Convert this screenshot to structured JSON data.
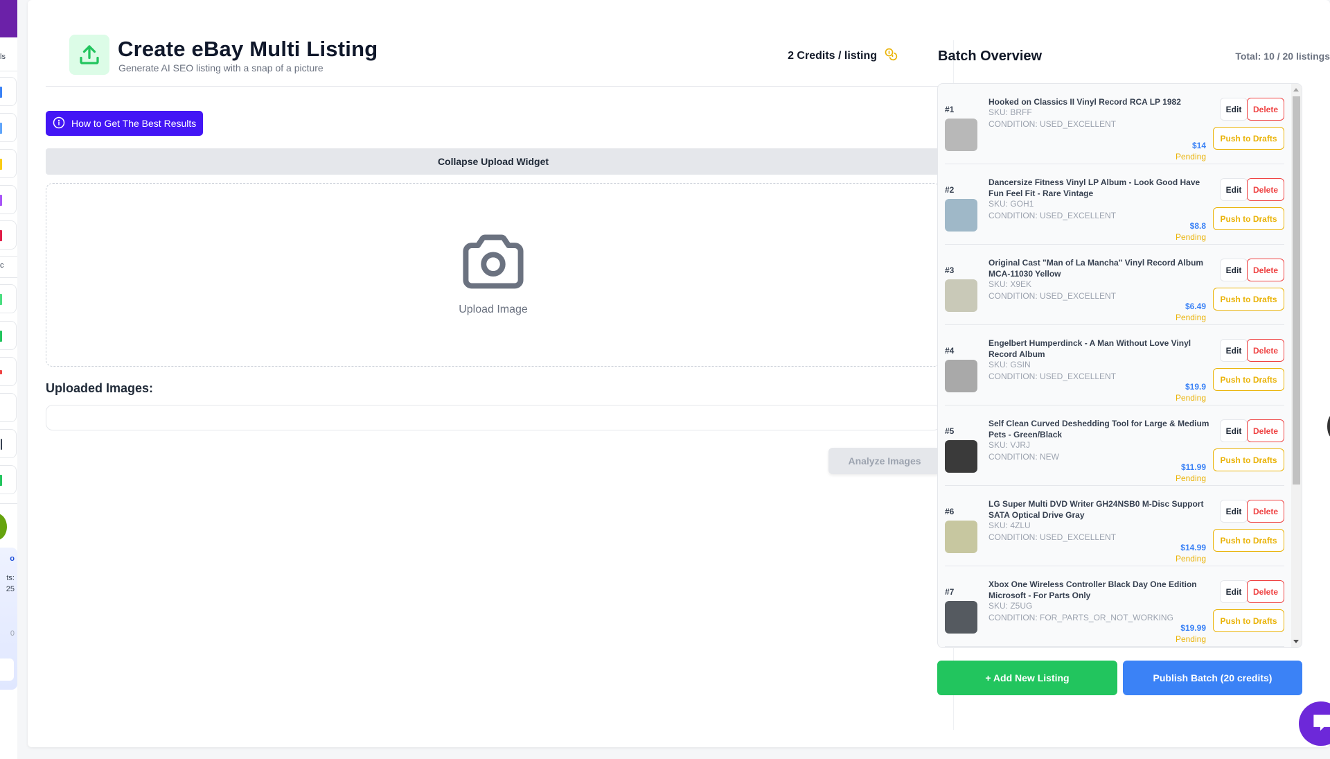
{
  "sidebar": {
    "partial_texts": [
      "ls",
      "c",
      "ts:",
      "25",
      "0"
    ]
  },
  "header": {
    "title": "Create eBay Multi Listing",
    "subtitle": "Generate AI SEO listing with a snap of a picture",
    "credits_label": "2 Credits / listing",
    "icon": "upload-icon",
    "credits_icon": "coins-icon"
  },
  "howto_button": {
    "label": "How to Get The Best Results",
    "icon": "info-icon"
  },
  "collapse_button": {
    "label": "Collapse Upload Widget"
  },
  "dropzone": {
    "label": "Upload Image",
    "icon": "camera-icon"
  },
  "uploaded": {
    "label": "Uploaded Images:"
  },
  "analyze_button": {
    "label": "Analyze Images"
  },
  "batch": {
    "title": "Batch Overview",
    "total": "Total: 10 / 20 listings",
    "edit_label": "Edit",
    "delete_label": "Delete",
    "push_label": "Push to Drafts",
    "items": [
      {
        "num": "#1",
        "title": "Hooked on Classics II Vinyl Record RCA LP 1982",
        "sku": "SKU: BRFF",
        "condition": "CONDITION: USED_EXCELLENT",
        "price": "$14",
        "status": "Pending",
        "thumb": "#b8b8b8"
      },
      {
        "num": "#2",
        "title": "Dancersize Fitness Vinyl LP Album - Look Good Have Fun Feel Fit - Rare Vintage",
        "sku": "SKU: GOH1",
        "condition": "CONDITION: USED_EXCELLENT",
        "price": "$8.8",
        "status": "Pending",
        "thumb": "#9fb8c8"
      },
      {
        "num": "#3",
        "title": "Original Cast \"Man of La Mancha\" Vinyl Record Album MCA-11030 Yellow",
        "sku": "SKU: X9EK",
        "condition": "CONDITION: USED_EXCELLENT",
        "price": "$6.49",
        "status": "Pending",
        "thumb": "#c9c9b8"
      },
      {
        "num": "#4",
        "title": "Engelbert Humperdinck - A Man Without Love Vinyl Record Album",
        "sku": "SKU: GSIN",
        "condition": "CONDITION: USED_EXCELLENT",
        "price": "$19.9",
        "status": "Pending",
        "thumb": "#a9a9a9"
      },
      {
        "num": "#5",
        "title": "Self Clean Curved Deshedding Tool for Large & Medium Pets - Green/Black",
        "sku": "SKU: VJRJ",
        "condition": "CONDITION: NEW",
        "price": "$11.99",
        "status": "Pending",
        "thumb": "#3a3a3a"
      },
      {
        "num": "#6",
        "title": "LG Super Multi DVD Writer GH24NSB0 M-Disc Support SATA Optical Drive Gray",
        "sku": "SKU: 4ZLU",
        "condition": "CONDITION: USED_EXCELLENT",
        "price": "$14.99",
        "status": "Pending",
        "thumb": "#c7c7a0"
      },
      {
        "num": "#7",
        "title": "Xbox One Wireless Controller Black Day One Edition Microsoft - For Parts Only",
        "sku": "SKU: Z5UG",
        "condition": "CONDITION: FOR_PARTS_OR_NOT_WORKING",
        "price": "$19.99",
        "status": "Pending",
        "thumb": "#555a60"
      }
    ]
  },
  "actions": {
    "add_label": "+ Add New Listing",
    "publish_label": "Publish Batch (20 credits)"
  },
  "colors": {
    "accent_purple": "#4316f5",
    "green": "#22c55e",
    "blue": "#3b82f6",
    "danger": "#ef4444",
    "warning": "#eab308"
  }
}
